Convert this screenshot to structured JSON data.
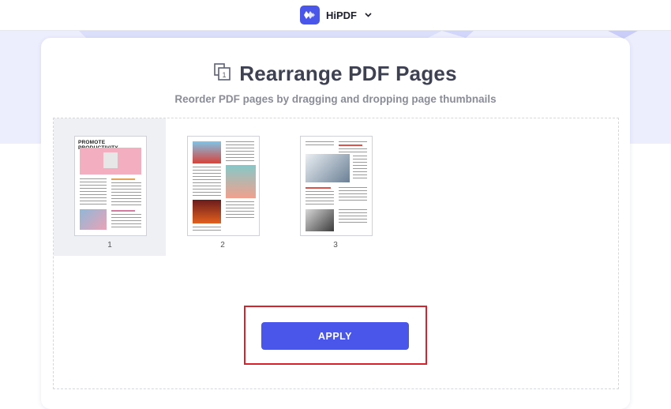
{
  "header": {
    "brand_name": "HiPDF",
    "logo_icon": "hipdf-logo-icon",
    "dropdown_icon": "chevron-down-icon"
  },
  "tool": {
    "icon": "rearrange-pages-icon",
    "title": "Rearrange PDF Pages",
    "subtitle": "Reorder PDF pages by dragging and dropping page thumbnails"
  },
  "pages": [
    {
      "number": "1",
      "selected": true,
      "heading": "PROMOTE PRODUCTIVITY"
    },
    {
      "number": "2",
      "selected": false
    },
    {
      "number": "3",
      "selected": false
    }
  ],
  "actions": {
    "apply_label": "APPLY"
  },
  "colors": {
    "accent": "#4a56ea",
    "hero_background": "#eceefe",
    "highlight_border": "#d8232f",
    "selected_thumb": "#eef0f4"
  }
}
